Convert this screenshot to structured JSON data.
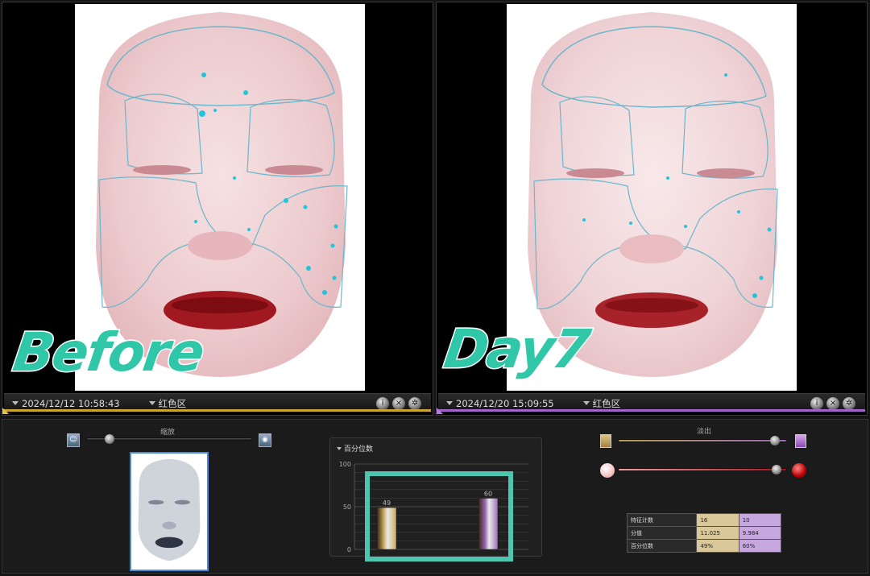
{
  "before": {
    "overlay_label": "Before",
    "timestamp": "2024/12/12 10:58:43",
    "region": "红色区",
    "accent": "#c8a43a"
  },
  "after": {
    "overlay_label": "Day7",
    "timestamp": "2024/12/20 15:09:55",
    "region": "红色区",
    "accent": "#a065c8"
  },
  "tools": {
    "icons": [
      "info-icon",
      "close-icon",
      "settings-icon"
    ]
  },
  "zoom": {
    "label": "缩放",
    "level": 0.14
  },
  "fade": {
    "label": "淡出",
    "level_top": 0.93,
    "level_bottom": 0.94
  },
  "percentile_panel": {
    "title": "百分位数"
  },
  "chart_data": {
    "type": "bar",
    "title": "百分位数",
    "categories": [
      "2024/12/12 10:58:43",
      "2024/12/20 15:09:55"
    ],
    "values": [
      49,
      60
    ],
    "ylim": [
      0,
      100
    ],
    "yticks": [
      0,
      50,
      100
    ],
    "grid": true,
    "colors": [
      "#c9a85a",
      "#9a6ab6"
    ]
  },
  "stats": {
    "rows": [
      {
        "label": "特征计数",
        "before": "16",
        "after": "10"
      },
      {
        "label": "分值",
        "before": "11.025",
        "after": "9.984"
      },
      {
        "label": "百分位数",
        "before": "49%",
        "after": "60%"
      }
    ]
  },
  "colors": {
    "highlight": "#4cc6ae",
    "label": "#2fc7a8"
  }
}
